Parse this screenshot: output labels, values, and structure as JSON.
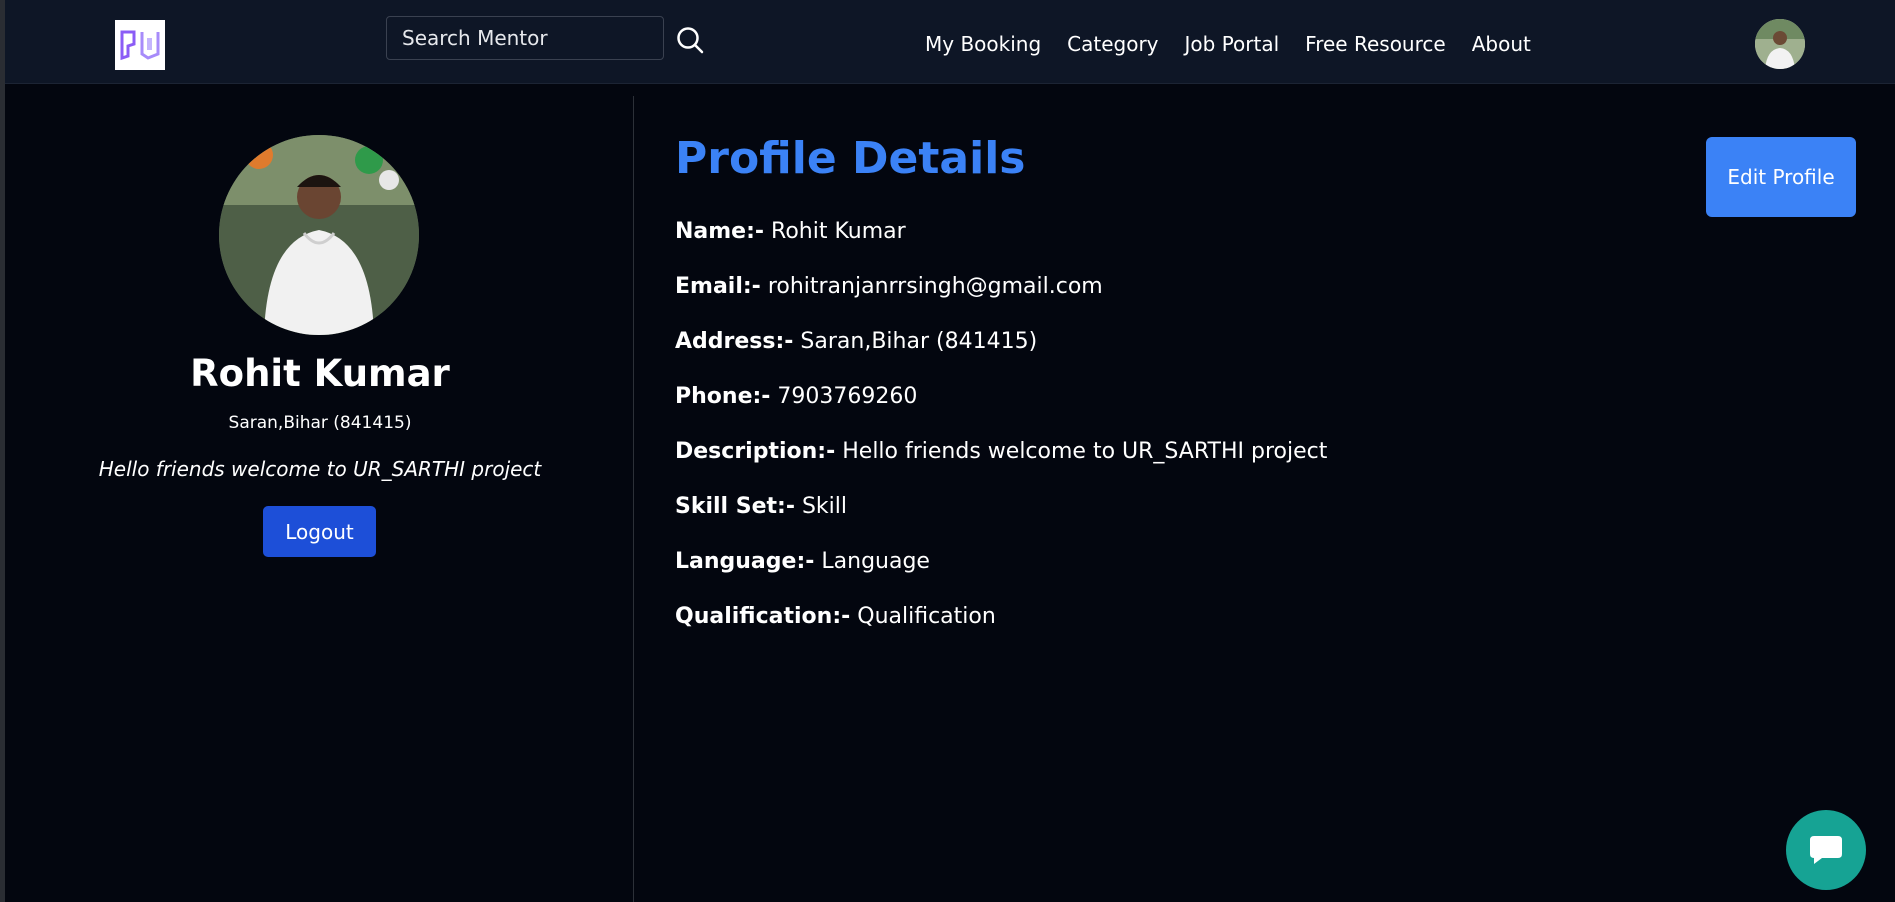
{
  "colors": {
    "background": "#03060f",
    "navbar": "#0e1626",
    "accent": "#3b82f6",
    "logout": "#1d4fd8",
    "chat": "#16a394"
  },
  "navbar": {
    "search_placeholder": "Search Mentor",
    "search_icon": "search-icon",
    "links": [
      {
        "label": "My Booking"
      },
      {
        "label": "Category"
      },
      {
        "label": "Job Portal"
      },
      {
        "label": "Free Resource"
      },
      {
        "label": "About"
      }
    ]
  },
  "profile_card": {
    "name": "Rohit Kumar",
    "location": "Saran,Bihar (841415)",
    "description": "Hello friends welcome to UR_SARTHI project",
    "logout_label": "Logout"
  },
  "details": {
    "title": "Profile Details",
    "edit_label": "Edit Profile",
    "rows": [
      {
        "label": "Name:-",
        "value": "Rohit Kumar"
      },
      {
        "label": "Email:-",
        "value": "rohitranjanrrsingh@gmail.com"
      },
      {
        "label": "Address:-",
        "value": "Saran,Bihar (841415)"
      },
      {
        "label": "Phone:-",
        "value": "7903769260"
      },
      {
        "label": "Description:-",
        "value": "Hello friends welcome to UR_SARTHI project"
      },
      {
        "label": "Skill Set:-",
        "value": "Skill"
      },
      {
        "label": "Language:-",
        "value": "Language"
      },
      {
        "label": "Qualification:-",
        "value": "Qualification"
      }
    ]
  },
  "chat": {
    "icon": "chat-bubble-icon"
  }
}
